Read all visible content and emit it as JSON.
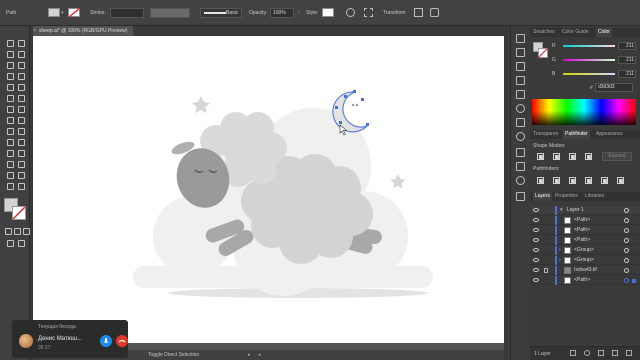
{
  "control_bar": {
    "selection_label": "Path",
    "stroke_label": "Stroke:",
    "stroke_style": "Basic",
    "opacity_label": "Opacity:",
    "opacity_value": "100%",
    "style_label": "Style:",
    "transform_label": "Transform"
  },
  "document": {
    "tab_title": "sheep.ai* @ 100% (RGB/GPU Preview)"
  },
  "status_bar": {
    "current_tool": "Toggle Direct Selection"
  },
  "color_panel": {
    "tabs": [
      "Swatches",
      "Color Guide",
      "Color"
    ],
    "active_tab": "Color",
    "channels": [
      {
        "label": "R",
        "value": "211"
      },
      {
        "label": "G",
        "value": "211"
      },
      {
        "label": "B",
        "value": "211"
      }
    ],
    "hex_prefix": "#",
    "hex_value": "d3d3d3",
    "fill_color": "#d3d3d3"
  },
  "pathfinder_panel": {
    "tabs": [
      "Transparen",
      "Pathfinder",
      "Appearance"
    ],
    "active_tab": "Pathfinder",
    "shape_modes_label": "Shape Modes:",
    "expand_label": "Expand",
    "pathfinders_label": "Pathfinders:"
  },
  "layers_panel": {
    "tabs": [
      "Layers",
      "Properties",
      "Libraries"
    ],
    "active_tab": "Layers",
    "rows": [
      {
        "name": "Layer 1",
        "kind": "layer"
      },
      {
        "name": "<Path>",
        "kind": "item"
      },
      {
        "name": "<Path>",
        "kind": "item"
      },
      {
        "name": "<Path>",
        "kind": "item"
      },
      {
        "name": "<Group>",
        "kind": "group"
      },
      {
        "name": "<Group>",
        "kind": "group"
      },
      {
        "name": "Ixdsa43.tif",
        "kind": "image"
      },
      {
        "name": "<Path>",
        "kind": "item"
      }
    ],
    "footer_count": "1 Layer"
  },
  "call_overlay": {
    "header": "Текущая беседа",
    "caller_name": "Денис Матюш...",
    "duration": "36:27"
  },
  "colors": {
    "ui_dark": "#424242",
    "artboard": "#ffffff",
    "sheep_body": "#d3d3d3",
    "sheep_face": "#9a9a9a",
    "selection_blue": "#4a6fd8",
    "mic_blue": "#1f8be8",
    "hangup_red": "#e0392b"
  }
}
